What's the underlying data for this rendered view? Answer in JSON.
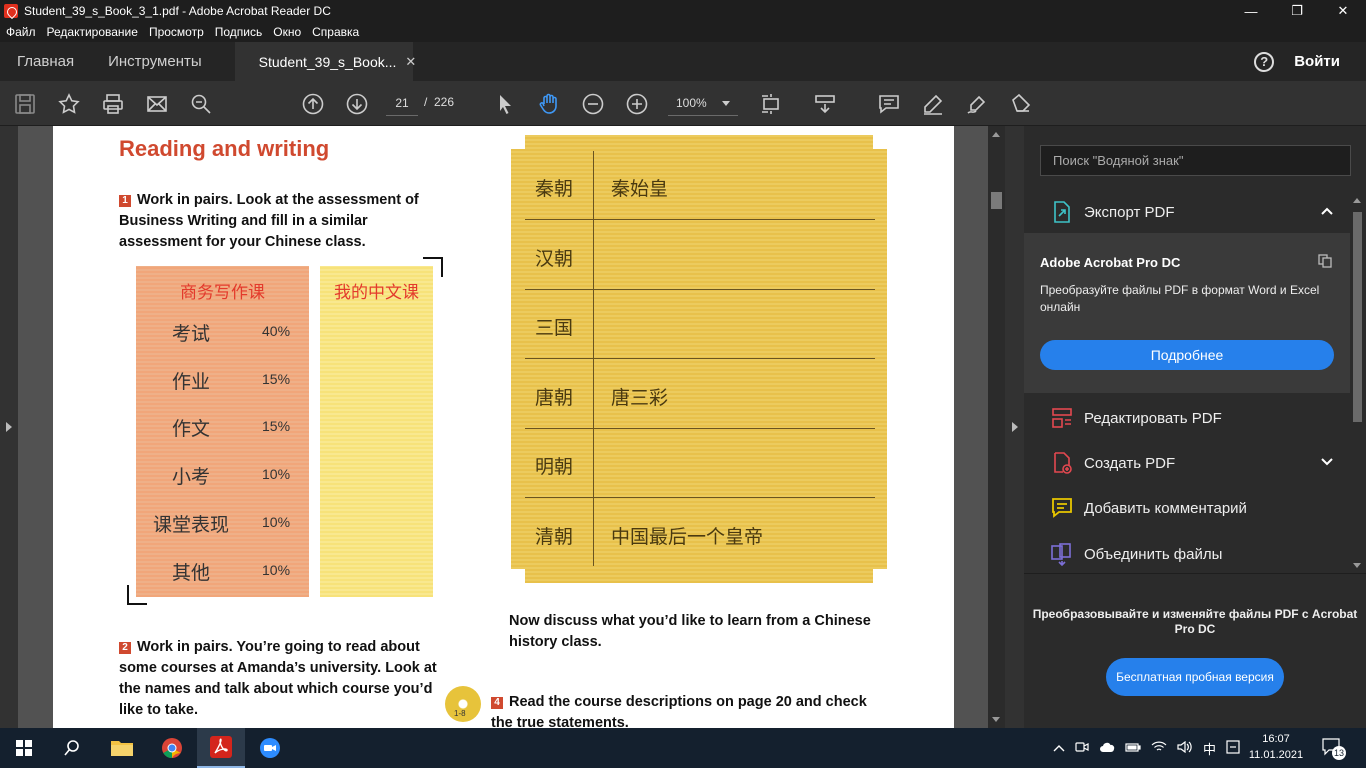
{
  "window": {
    "title": "Student_39_s_Book_3_1.pdf - Adobe Acrobat Reader DC",
    "minimize": "—",
    "maximize": "❐",
    "close": "✕"
  },
  "menu": [
    "Файл",
    "Редактирование",
    "Просмотр",
    "Подпись",
    "Окно",
    "Справка"
  ],
  "tabs": {
    "home": "Главная",
    "tools": "Инструменты",
    "document": "Student_39_s_Book...",
    "close": "✕",
    "help": "?",
    "signin": "Войти"
  },
  "toolbar": {
    "page_current": "21",
    "page_sep": "/",
    "page_total": "226",
    "zoom": "100%"
  },
  "right_panel": {
    "search_placeholder": "Поиск \"Водяной знак\"",
    "export_label": "Экспорт PDF",
    "promo_title": "Adobe Acrobat Pro DC",
    "promo_text": "Преобразуйте файлы PDF в формат Word и Excel онлайн",
    "promo_button": "Подробнее",
    "items": [
      {
        "label": "Редактировать PDF",
        "icon": "edit-pdf-icon",
        "color": "#e34850"
      },
      {
        "label": "Создать PDF",
        "icon": "create-pdf-icon",
        "color": "#e34850"
      },
      {
        "label": "Добавить комментарий",
        "icon": "comment-icon",
        "color": "#e8c600"
      },
      {
        "label": "Объединить файлы",
        "icon": "combine-files-icon",
        "color": "#7c6fd7"
      }
    ],
    "bottom_promo": "Преобразовывайте и изменяйте файлы PDF с Acrobat Pro DC",
    "trial_button": "Бесплатная пробная версия"
  },
  "pdf": {
    "heading": "Reading and writing",
    "ex1_num": "1",
    "ex1_text": "Work in pairs. Look at the assessment of Business Writing and fill in a similar assessment for your Chinese class.",
    "table1_header": "商务写作课",
    "table1_rows": [
      {
        "name": "考试",
        "value": "40%"
      },
      {
        "name": "作业",
        "value": "15%"
      },
      {
        "name": "作文",
        "value": "15%"
      },
      {
        "name": "小考",
        "value": "10%"
      },
      {
        "name": "课堂表现",
        "value": "10%"
      },
      {
        "name": "其他",
        "value": "10%"
      }
    ],
    "table2_header": "我的中文课",
    "dynasties": [
      {
        "name": "秦朝",
        "desc": "秦始皇"
      },
      {
        "name": "汉朝",
        "desc": ""
      },
      {
        "name": "三国",
        "desc": ""
      },
      {
        "name": "唐朝",
        "desc": "唐三彩"
      },
      {
        "name": "明朝",
        "desc": ""
      },
      {
        "name": "清朝",
        "desc": "中国最后一个皇帝"
      }
    ],
    "discuss_text": "Now discuss what you’d like to learn from a Chinese history class.",
    "ex2_num": "2",
    "ex2_text": "Work in pairs. You’re going to read about some courses at Amanda’s university. Look at the names and talk about which course you’d like to take.",
    "cd_label": "1-8",
    "ex4_num": "4",
    "ex4_text": "Read the course descriptions on page 20 and check the true statements."
  },
  "taskbar": {
    "time": "16:07",
    "date": "11.01.2021",
    "lang": "中",
    "notifications": "13"
  },
  "colors": {
    "accent": "#2680eb",
    "pdf_red": "#d0492f"
  }
}
